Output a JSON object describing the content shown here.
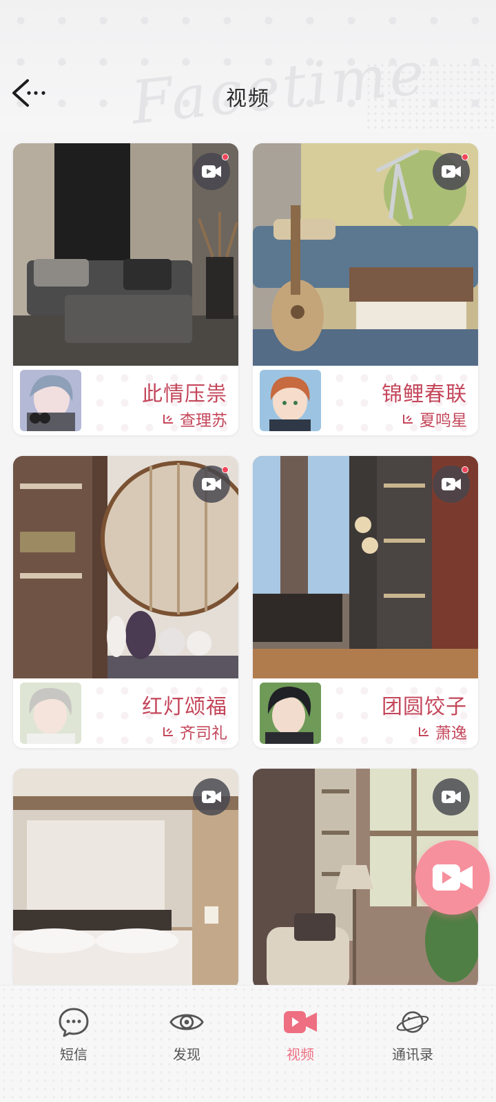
{
  "header": {
    "title": "视频",
    "watermark": "Facetime",
    "back_icon": "back-arrow-icon"
  },
  "cards": [
    {
      "title": "此情压祟",
      "character": "查理苏",
      "has_new": true,
      "scene_colors": [
        "#3a3836",
        "#b9b2a6"
      ]
    },
    {
      "title": "锦鲤春联",
      "character": "夏鸣星",
      "has_new": true,
      "scene_colors": [
        "#6c8aa0",
        "#e8dfc8"
      ]
    },
    {
      "title": "红灯颂福",
      "character": "齐司礼",
      "has_new": true,
      "scene_colors": [
        "#7a5e4f",
        "#ded6cc"
      ]
    },
    {
      "title": "团圆饺子",
      "character": "萧逸",
      "has_new": true,
      "scene_colors": [
        "#4c4540",
        "#bfd9ea"
      ]
    },
    {
      "title": "",
      "character": "",
      "has_new": false,
      "scene_colors": [
        "#8a7563",
        "#e9e3da"
      ]
    },
    {
      "title": "",
      "character": "",
      "has_new": false,
      "scene_colors": [
        "#6e5b55",
        "#dfd6c7"
      ]
    }
  ],
  "fab": {
    "icon": "video-camera-icon"
  },
  "nav": [
    {
      "label": "短信",
      "icon": "message-bubble-icon",
      "active": false
    },
    {
      "label": "发现",
      "icon": "eye-icon",
      "active": false
    },
    {
      "label": "视频",
      "icon": "video-camera-icon",
      "active": true
    },
    {
      "label": "通讯录",
      "icon": "planet-contacts-icon",
      "active": false
    }
  ],
  "colors": {
    "accent": "#ee6f82",
    "title_red": "#c4465a",
    "fab": "#f7909d",
    "new_dot": "#f0455a"
  }
}
